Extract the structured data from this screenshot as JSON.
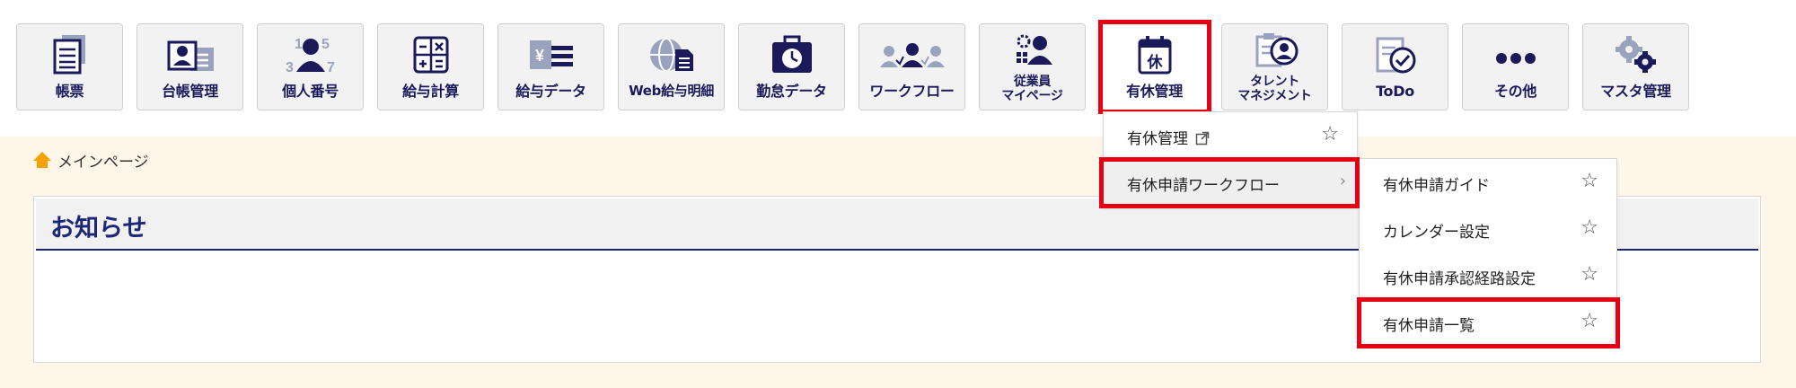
{
  "colors": {
    "accent": "#1d2778",
    "highlight": "#e60012",
    "content_bg": "#fff6ea",
    "tile_bg": "#f2f2f2",
    "home_icon": "#f5a200"
  },
  "nav": {
    "tiles": [
      {
        "label": "帳票",
        "icon": "document-stack-icon"
      },
      {
        "label": "台帳管理",
        "icon": "id-card-icon"
      },
      {
        "label": "個人番号",
        "icon": "person-number-icon"
      },
      {
        "label": "給与計算",
        "icon": "calculator-icon"
      },
      {
        "label": "給与データ",
        "icon": "yen-list-icon"
      },
      {
        "label": "Web給与明細",
        "icon": "globe-document-icon"
      },
      {
        "label": "勤怠データ",
        "icon": "clock-briefcase-icon"
      },
      {
        "label": "ワークフロー",
        "icon": "people-flow-icon"
      },
      {
        "label_line1": "従業員",
        "label_line2": "マイページ",
        "icon": "employee-gear-icon"
      },
      {
        "label": "有休管理",
        "icon": "calendar-holiday-icon",
        "icon_char": "休"
      },
      {
        "label_line1": "タレント",
        "label_line2": "マネジメント",
        "icon": "talent-clipboard-icon"
      },
      {
        "label": "ToDo",
        "icon": "todo-check-icon"
      },
      {
        "label": "その他",
        "icon": "more-dots-icon"
      },
      {
        "label": "マスタ管理",
        "icon": "gears-icon"
      }
    ]
  },
  "breadcrumb": {
    "label": "メインページ",
    "icon": "home-icon"
  },
  "notice": {
    "title": "お知らせ"
  },
  "menu_level1": {
    "items": [
      {
        "label": "有休管理",
        "icon": "external-link-icon",
        "star": "☆"
      },
      {
        "label": "有休申請ワークフロー",
        "chevron": "›"
      }
    ]
  },
  "menu_level2": {
    "items": [
      {
        "label": "有休申請ガイド",
        "star": "☆"
      },
      {
        "label": "カレンダー設定",
        "star": "☆"
      },
      {
        "label": "有休申請承認経路設定",
        "star": "☆"
      },
      {
        "label": "有休申請一覧",
        "star": "☆"
      }
    ]
  }
}
